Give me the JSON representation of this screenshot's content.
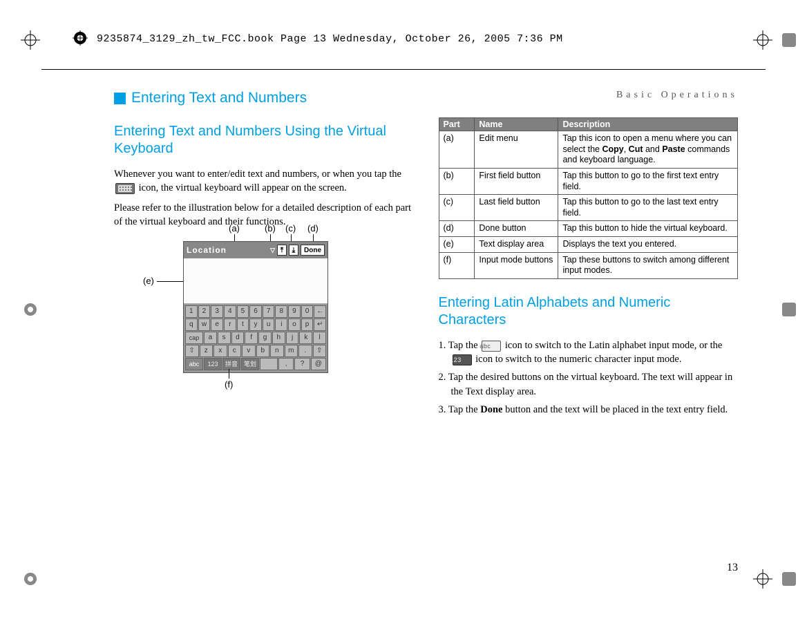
{
  "meta": {
    "header_line": "9235874_3129_zh_tw_FCC.book  Page 13  Wednesday, October 26, 2005  7:36 PM",
    "running_head": "Basic Operations",
    "page_number": "13"
  },
  "left": {
    "h1": "Entering Text and Numbers",
    "h2": "Entering Text and Numbers Using the Virtual Keyboard",
    "p1a": "Whenever you want to enter/edit text and numbers, or when you tap the ",
    "p1b": " icon, the virtual keyboard will appear on the screen.",
    "p2": "Please refer to the illustration below for a detailed description of each part of the virtual keyboard and their functions.",
    "callouts": {
      "a": "(a)",
      "b": "(b)",
      "c": "(c)",
      "d": "(d)",
      "e": "(e)",
      "f": "(f)"
    },
    "vk_title": "Location",
    "vk_done": "Done"
  },
  "right": {
    "table": {
      "head": {
        "part": "Part",
        "name": "Name",
        "desc": "Description"
      },
      "rows": [
        {
          "part": "(a)",
          "name": "Edit menu",
          "desc": "Tap this icon to open a menu where you can select the <b>Copy</b>, <b>Cut</b> and <b>Paste</b> commands and keyboard language."
        },
        {
          "part": "(b)",
          "name": "First field button",
          "desc": "Tap this button to go to the first text entry field."
        },
        {
          "part": "(c)",
          "name": "Last field button",
          "desc": "Tap this button to go to the last text entry field."
        },
        {
          "part": "(d)",
          "name": "Done button",
          "desc": "Tap this button to hide the virtual keyboard."
        },
        {
          "part": "(e)",
          "name": "Text display area",
          "desc": "Displays the text you entered."
        },
        {
          "part": "(f)",
          "name": "Input mode buttons",
          "desc": "Tap these buttons to switch among different input modes."
        }
      ]
    },
    "h2": "Entering Latin Alphabets and Numeric Characters",
    "step1a": "1. Tap the ",
    "step1b": " icon to switch to the Latin alphabet input mode, or the ",
    "step1c": " icon to switch to the numeric character input mode.",
    "step2": "2. Tap the desired buttons on the virtual keyboard. The text will appear in the Text display area.",
    "step3a": "3. Tap the ",
    "step3_bold": "Done",
    "step3b": " button and the text will be placed in the text entry field."
  },
  "keyboard_rows": {
    "r1": [
      "1",
      "2",
      "3",
      "4",
      "5",
      "6",
      "7",
      "8",
      "9",
      "0",
      "←"
    ],
    "r2": [
      "q",
      "w",
      "e",
      "r",
      "t",
      "y",
      "u",
      "i",
      "o",
      "p",
      "↵"
    ],
    "r3": [
      "cap",
      "a",
      "s",
      "d",
      "f",
      "g",
      "h",
      "j",
      "k",
      "l"
    ],
    "r4": [
      "⇧",
      "z",
      "x",
      "c",
      "v",
      "b",
      "n",
      "m",
      ".",
      "⇧"
    ],
    "r5": [
      "abc",
      "123",
      "拼音",
      "笔划",
      " ",
      ",",
      "?",
      "@"
    ]
  }
}
